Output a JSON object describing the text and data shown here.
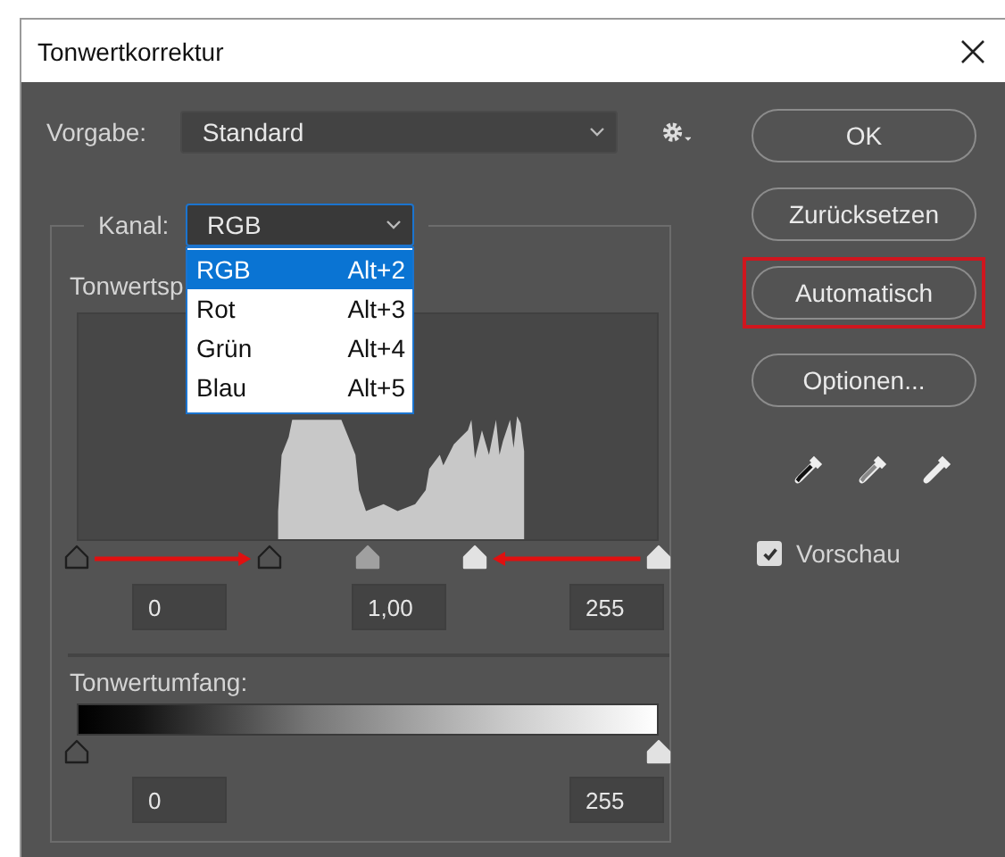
{
  "window": {
    "title": "Tonwertkorrektur"
  },
  "preset": {
    "label": "Vorgabe:",
    "value": "Standard"
  },
  "channel": {
    "label": "Kanal:",
    "value": "RGB",
    "menu_open": true,
    "options": [
      {
        "label": "RGB",
        "shortcut": "Alt+2",
        "selected": true
      },
      {
        "label": "Rot",
        "shortcut": "Alt+3",
        "selected": false
      },
      {
        "label": "Grün",
        "shortcut": "Alt+4",
        "selected": false
      },
      {
        "label": "Blau",
        "shortcut": "Alt+5",
        "selected": false
      }
    ]
  },
  "input_levels": {
    "label": "Tonwertsp",
    "sliders": [
      {
        "kind": "shadow"
      },
      {
        "kind": "shadow"
      },
      {
        "kind": "midtone"
      },
      {
        "kind": "highlight"
      },
      {
        "kind": "highlight"
      }
    ],
    "fields": [
      "0",
      "1,00",
      "255"
    ]
  },
  "output_levels": {
    "label": "Tonwertumfang:",
    "sliders": [
      {
        "kind": "shadow"
      },
      {
        "kind": "highlight"
      }
    ],
    "fields": [
      "0",
      "255"
    ]
  },
  "buttons": [
    {
      "label": "OK",
      "highlighted": false
    },
    {
      "label": "Zurücksetzen",
      "highlighted": false
    },
    {
      "label": "Automatisch",
      "highlighted": true
    },
    {
      "label": "Optionen...",
      "highlighted": false
    }
  ],
  "preview": {
    "label": "Vorschau",
    "checked": true
  }
}
